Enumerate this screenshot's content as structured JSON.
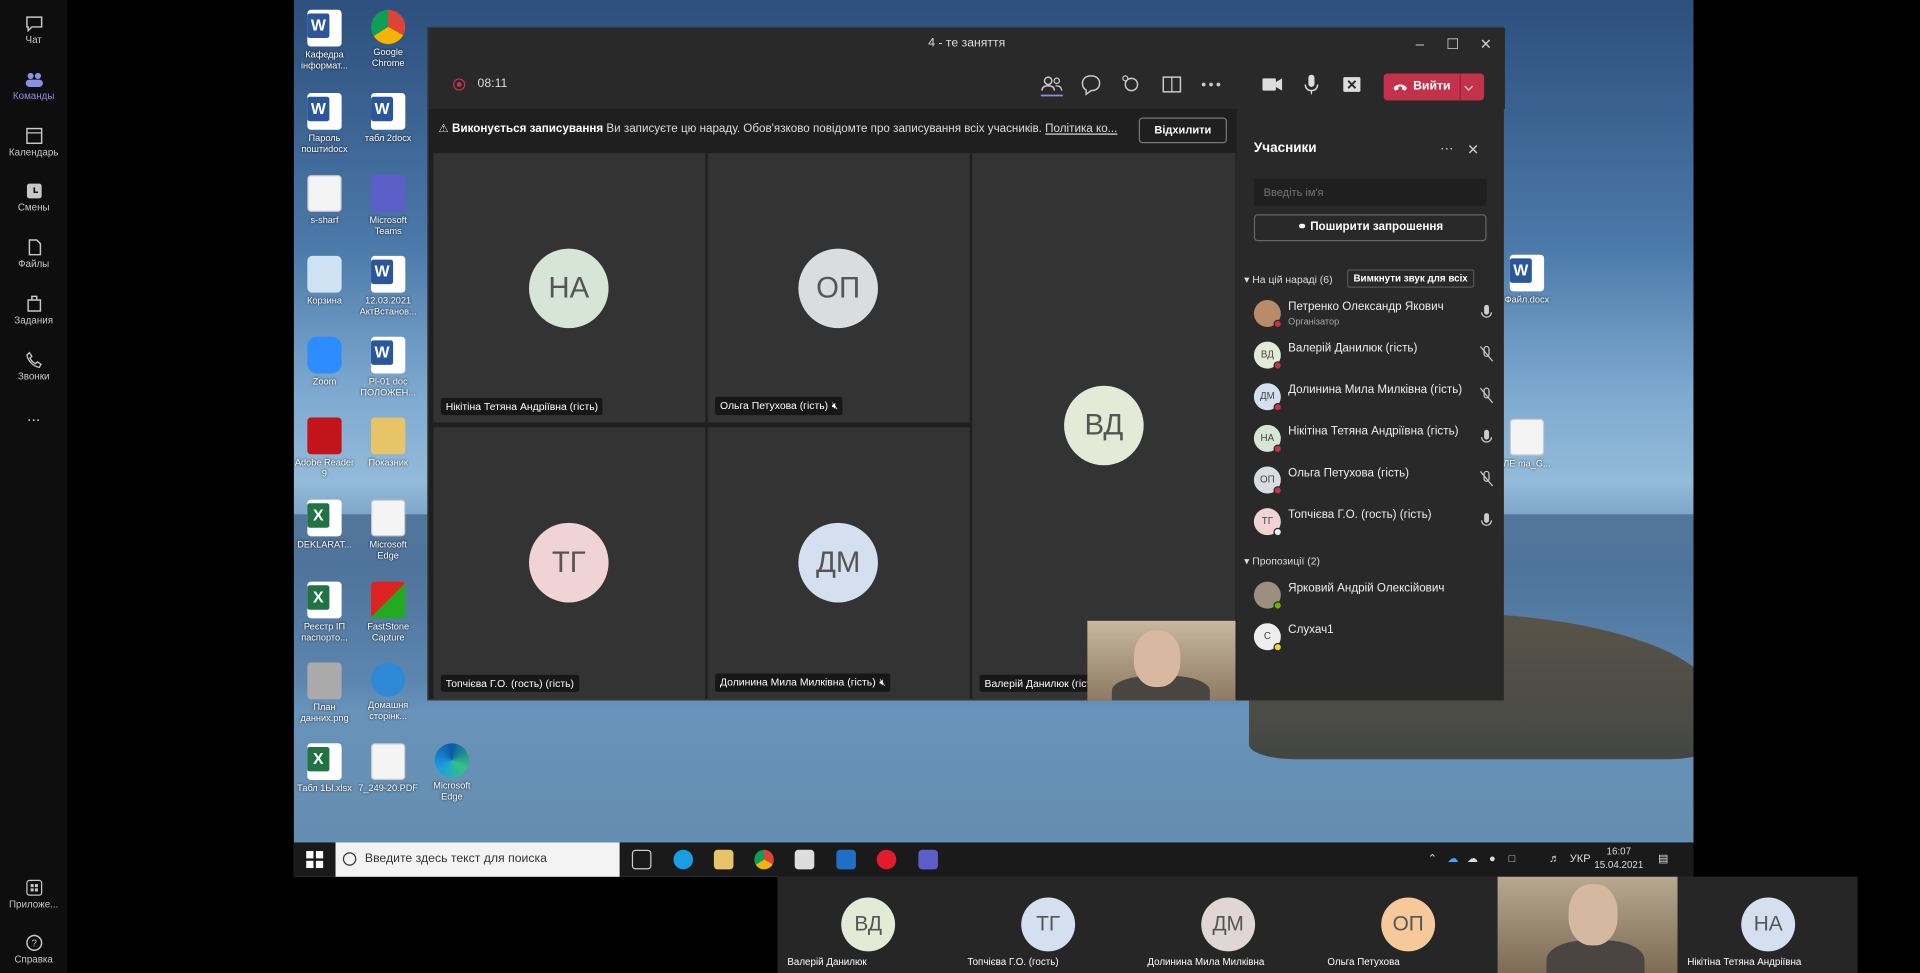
{
  "rail": {
    "items": [
      {
        "label": "Чат",
        "icon": "chat-icon"
      },
      {
        "label": "Команды",
        "icon": "teams-icon",
        "active": true
      },
      {
        "label": "Календарь",
        "icon": "calendar-icon"
      },
      {
        "label": "Смены",
        "icon": "shifts-icon"
      },
      {
        "label": "Файлы",
        "icon": "files-icon"
      },
      {
        "label": "Задания",
        "icon": "assignments-icon"
      },
      {
        "label": "Звонки",
        "icon": "calls-icon"
      }
    ],
    "more": "...",
    "apps_label": "Приложе...",
    "help_label": "Справка"
  },
  "desktop": {
    "icons": [
      {
        "label": "Кафедра інформат...",
        "type": "word"
      },
      {
        "label": "Google Chrome",
        "type": "chrome"
      },
      {
        "label": "Пароль поштиdocx",
        "type": "word"
      },
      {
        "label": "табл 2docx",
        "type": "word"
      },
      {
        "label": "s-sharf",
        "type": "file"
      },
      {
        "label": "Microsoft Teams",
        "type": "teams"
      },
      {
        "label": "Корзина",
        "type": "recycle"
      },
      {
        "label": "12.03.2021 АктВстанов...",
        "type": "word"
      },
      {
        "label": "Zoom",
        "type": "zoom"
      },
      {
        "label": "Pl-01 doc ПОЛОЖЕН...",
        "type": "word"
      },
      {
        "label": "Adobe Reader 9",
        "type": "pdf"
      },
      {
        "label": "Показник",
        "type": "folder"
      },
      {
        "label": "DEKLARAT...",
        "type": "excel"
      },
      {
        "label": "Microsoft Edge",
        "type": "file"
      },
      {
        "label": "Реєстр ІП паспорто...",
        "type": "excel"
      },
      {
        "label": "FastStone Capture",
        "type": "fs"
      },
      {
        "label": "План данних.png",
        "type": "plan"
      },
      {
        "label": "Домашня сторінк...",
        "type": "ie"
      },
      {
        "label": "Табл 1Ы.xlsx",
        "type": "excel"
      },
      {
        "label": "7_249-20.PDF",
        "type": "file"
      },
      {
        "label": "Microsoft Edge",
        "type": "edge"
      },
      {
        "label": "Файл.docx",
        "type": "word"
      },
      {
        "label": "ЛЕ ma_G...",
        "type": "file"
      }
    ]
  },
  "meeting": {
    "title": "4 - те заняття",
    "timer": "08:11",
    "leave_label": "Вийти",
    "banner": {
      "title": "Виконується записування",
      "text": "Ви записуєте цю нараду. Обов'язково повідомте про записування всіх учасників.",
      "link": "Політика ко...",
      "dismiss": "Відхилити"
    },
    "tiles": [
      {
        "initials": "НА",
        "name": "Нікітіна Тетяна Андріївна (гість)",
        "color": "#d7e5d7",
        "muted": false
      },
      {
        "initials": "ОП",
        "name": "Ольга Петухова (гість)",
        "color": "#d9dde0",
        "muted": true
      },
      {
        "initials": "ВД",
        "name": "Валерій Данилюк (гість)",
        "color": "#e3ead6",
        "muted": false
      },
      {
        "initials": "ТГ",
        "name": "Топчієва Г.О. (гость) (гість)",
        "color": "#f0d3d5",
        "muted": false
      },
      {
        "initials": "ДМ",
        "name": "Долинина Мила Милківна (гість)",
        "color": "#d4e0f0",
        "muted": true
      }
    ]
  },
  "participants": {
    "title": "Учасники",
    "search_placeholder": "Введіть ім'я",
    "share_label": "Поширити запрошення",
    "in_meeting_label": "На цій нараді (6)",
    "mute_all_label": "Вимкнути звук для всіх",
    "in_meeting": [
      {
        "initials": "",
        "name": "Петренко Олександр Якович",
        "role": "Організатор",
        "mic": "on",
        "color": "#b98b6a"
      },
      {
        "initials": "ВД",
        "name": "Валерій Данилюк (гість)",
        "role": "",
        "mic": "off",
        "color": "#e3ead6"
      },
      {
        "initials": "ДМ",
        "name": "Долинина Мила Милківна (гість)",
        "role": "",
        "mic": "off",
        "color": "#d4e0f0"
      },
      {
        "initials": "НА",
        "name": "Нікітіна Тетяна Андріївна (гість)",
        "role": "",
        "mic": "on",
        "color": "#d7e5d7"
      },
      {
        "initials": "ОП",
        "name": "Ольга Петухова (гість)",
        "role": "",
        "mic": "off",
        "color": "#d9dde0"
      },
      {
        "initials": "ТГ",
        "name": "Топчієва Г.О. (гость) (гість)",
        "role": "",
        "mic": "on",
        "color": "#f0d3d5"
      }
    ],
    "suggestions_label": "Пропозиції (2)",
    "suggestions": [
      {
        "initials": "",
        "name": "Ярковий Андрій Олексійович",
        "color": "#9c8f80"
      },
      {
        "initials": "С",
        "name": "Слухач1",
        "color": "#eeeeee"
      }
    ]
  },
  "taskbar": {
    "search_placeholder": "Введите здесь текст для поиска",
    "lang": "УКР",
    "time": "16:07",
    "date": "15.04.2021"
  },
  "strip": [
    {
      "initials": "ВД",
      "name": "Валерій Данилюк",
      "color": "#e3ead6"
    },
    {
      "initials": "ТГ",
      "name": "Топчієва Г.О. (гость)",
      "color": "#d4e0f0"
    },
    {
      "initials": "ДМ",
      "name": "Долинина Мила Милківна",
      "color": "#e1d6d6"
    },
    {
      "initials": "ОП",
      "name": "Ольга Петухова",
      "color": "#f6c99a"
    },
    {
      "initials": "НА",
      "name": "Нікітіна Тетяна Андріївна",
      "color": "#d4e0f0"
    }
  ]
}
